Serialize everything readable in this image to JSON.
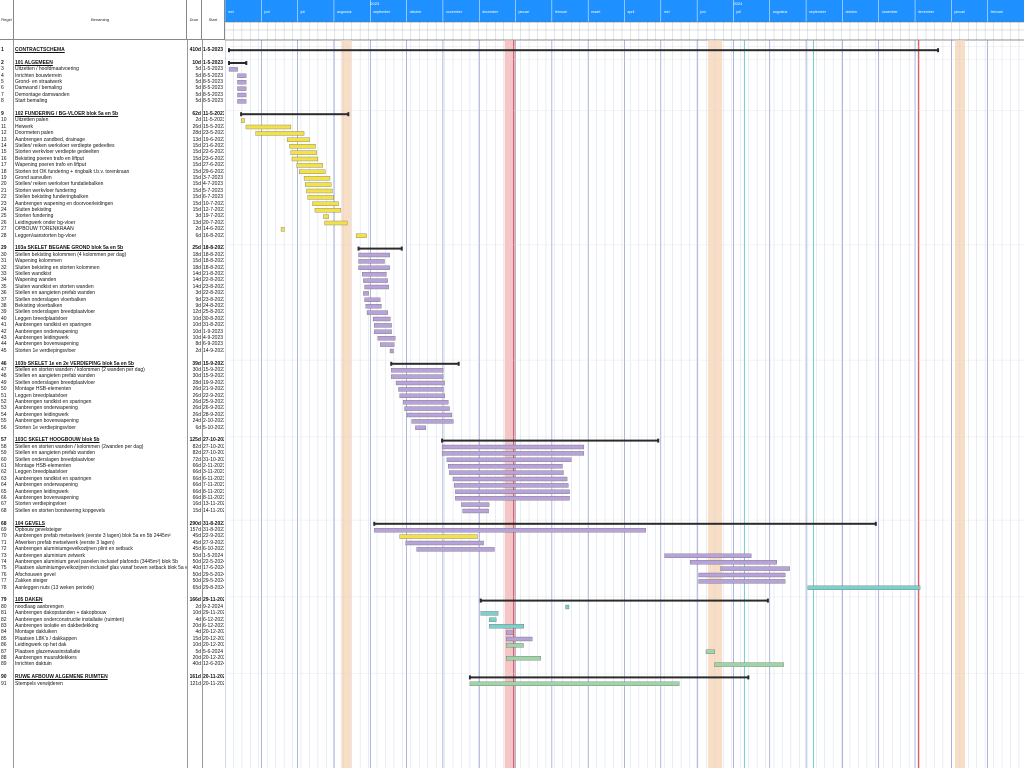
{
  "table": {
    "headers": {
      "id": "Regel",
      "name": "Benaming",
      "duration": "Duur",
      "start": "Start"
    },
    "rows": [
      {
        "n": "1",
        "name": "CONTRACTSCHEMA",
        "dur": "410d",
        "start": "1-5-2023",
        "summary": true
      },
      {
        "n": "",
        "name": "",
        "dur": "",
        "start": ""
      },
      {
        "n": "2",
        "name": "101 ALGEMEEN",
        "dur": "10d",
        "start": "1-5-2023",
        "summary": true
      },
      {
        "n": "3",
        "name": "Uitzetten / hoofdmaatvoering",
        "dur": "5d",
        "start": "1-5-2023"
      },
      {
        "n": "4",
        "name": "Inrichten bouwterrein",
        "dur": "5d",
        "start": "8-5-2023"
      },
      {
        "n": "5",
        "name": "Grond- en straatwerk",
        "dur": "5d",
        "start": "8-5-2023"
      },
      {
        "n": "6",
        "name": "Damwand / bemaling",
        "dur": "5d",
        "start": "8-5-2023"
      },
      {
        "n": "7",
        "name": "Demontage damwanden",
        "dur": "5d",
        "start": "8-5-2023"
      },
      {
        "n": "8",
        "name": "Start bemaling",
        "dur": "5d",
        "start": "8-5-2023"
      },
      {
        "n": "",
        "name": "",
        "dur": "",
        "start": ""
      },
      {
        "n": "9",
        "name": "102 FUNDERING / BG-VLOER blok 5a en 5b",
        "dur": "62d",
        "start": "11-5-2023",
        "summary": true
      },
      {
        "n": "10",
        "name": "Uitzetten palen",
        "dur": "2d",
        "start": "11-5-2023"
      },
      {
        "n": "11",
        "name": "Heiwerk",
        "dur": "26d",
        "start": "15-5-2023"
      },
      {
        "n": "12",
        "name": "Doormeten palen",
        "dur": "28d",
        "start": "23-5-2023"
      },
      {
        "n": "13",
        "name": "Aanbrengen zandbed, drainage",
        "dur": "13d",
        "start": "19-6-2023"
      },
      {
        "n": "14",
        "name": "Stellen/ reiken werkvloer verdiepte gedeeltes",
        "dur": "15d",
        "start": "21-6-2023"
      },
      {
        "n": "15",
        "name": "Storten werkvloer verdiepte gedeelten",
        "dur": "15d",
        "start": "22-6-2023"
      },
      {
        "n": "16",
        "name": "Bekisting poeren trafo en liftput",
        "dur": "15d",
        "start": "23-6-2023"
      },
      {
        "n": "17",
        "name": "Wapening poeren trafo en liftput",
        "dur": "15d",
        "start": "27-6-2023"
      },
      {
        "n": "18",
        "name": "Storten tot OK fundering + ringbalk t.b.v. torenkraan",
        "dur": "15d",
        "start": "29-6-2023"
      },
      {
        "n": "19",
        "name": "Grond aanvullen",
        "dur": "15d",
        "start": "3-7-2023"
      },
      {
        "n": "20",
        "name": "Stellen/ reiken werkvloer fundatiebalken",
        "dur": "15d",
        "start": "4-7-2023"
      },
      {
        "n": "21",
        "name": "Storten werkvloer fundering",
        "dur": "15d",
        "start": "5-7-2023"
      },
      {
        "n": "22",
        "name": "Stellen bekisting funderingbalken",
        "dur": "15d",
        "start": "6-7-2023"
      },
      {
        "n": "23",
        "name": "Aanbrengen wapening en doorvoerleidingen",
        "dur": "15d",
        "start": "10-7-2023"
      },
      {
        "n": "24",
        "name": "Sluiten bekisting",
        "dur": "15d",
        "start": "12-7-2023"
      },
      {
        "n": "25",
        "name": "Storten fundering",
        "dur": "3d",
        "start": "19-7-2023"
      },
      {
        "n": "26",
        "name": "Leidingwerk onder bg-vloer",
        "dur": "13d",
        "start": "20-7-2023"
      },
      {
        "n": "27",
        "name": "OPBOUW TORENKRAAN",
        "dur": "2d",
        "start": "14-6-2023"
      },
      {
        "n": "28",
        "name": "Leggen/aanstorten bg-vloer",
        "dur": "6d",
        "start": "16-8-2023"
      },
      {
        "n": "",
        "name": "",
        "dur": "",
        "start": ""
      },
      {
        "n": "29",
        "name": "103a SKELET BEGANE GROND blok 5a en 5b",
        "dur": "25d",
        "start": "18-8-2023",
        "summary": true
      },
      {
        "n": "30",
        "name": "Stellen bekisting kolommen (4 kolommen per dag)",
        "dur": "18d",
        "start": "18-8-2023"
      },
      {
        "n": "31",
        "name": "Wapening kolommen",
        "dur": "15d",
        "start": "18-8-2023"
      },
      {
        "n": "32",
        "name": "Sluiten bekisting en storten kolommen",
        "dur": "18d",
        "start": "18-8-2023"
      },
      {
        "n": "33",
        "name": "Stellen wandkist",
        "dur": "14d",
        "start": "21-8-2023"
      },
      {
        "n": "34",
        "name": "Wapening wanden",
        "dur": "14d",
        "start": "22-8-2023"
      },
      {
        "n": "35",
        "name": "Sluiten wandkist en storten wanden",
        "dur": "14d",
        "start": "23-8-2023"
      },
      {
        "n": "36",
        "name": "Stellen en aangieten prefab wanden",
        "dur": "3d",
        "start": "22-8-2023"
      },
      {
        "n": "37",
        "name": "Stellen onderslagen vloerbalken",
        "dur": "9d",
        "start": "23-8-2023"
      },
      {
        "n": "38",
        "name": "Bekisting vloerbalken",
        "dur": "9d",
        "start": "24-8-2023"
      },
      {
        "n": "39",
        "name": "Stellen onderslagen breedplaatvloer",
        "dur": "12d",
        "start": "25-8-2023"
      },
      {
        "n": "40",
        "name": "Leggen breedplaatvloer",
        "dur": "10d",
        "start": "30-8-2023"
      },
      {
        "n": "41",
        "name": "Aanbrengen randkist en sparingen",
        "dur": "10d",
        "start": "31-8-2023"
      },
      {
        "n": "42",
        "name": "Aanbrengen onderwapening",
        "dur": "10d",
        "start": "1-9-2023"
      },
      {
        "n": "43",
        "name": "Aanbrengen leidingwerk",
        "dur": "10d",
        "start": "4-9-2023"
      },
      {
        "n": "44",
        "name": "Aanbrengen bovenwapening",
        "dur": "8d",
        "start": "6-9-2023"
      },
      {
        "n": "45",
        "name": "Storten 1e verdiepingsvloer",
        "dur": "2d",
        "start": "14-9-2023"
      },
      {
        "n": "",
        "name": "",
        "dur": "",
        "start": ""
      },
      {
        "n": "46",
        "name": "103b SKELET 1e en 2e VERDIEPING blok 5a en 5b",
        "dur": "39d",
        "start": "15-9-2023",
        "summary": true
      },
      {
        "n": "47",
        "name": "Stellen en storten wanden / kolommen (2 wanden per dag)",
        "dur": "30d",
        "start": "15-9-2023"
      },
      {
        "n": "48",
        "name": "Stellen en aangieten prefab wanden",
        "dur": "30d",
        "start": "15-9-2023"
      },
      {
        "n": "49",
        "name": "Stellen onderslagen breedplaatvloer",
        "dur": "28d",
        "start": "19-9-2023"
      },
      {
        "n": "50",
        "name": "Montage HSB-elementen",
        "dur": "26d",
        "start": "21-9-2023"
      },
      {
        "n": "51",
        "name": "Leggen breedplaatvloer",
        "dur": "26d",
        "start": "22-9-2023"
      },
      {
        "n": "52",
        "name": "Aanbrengen randkist en sparingen",
        "dur": "26d",
        "start": "25-9-2023"
      },
      {
        "n": "53",
        "name": "Aanbrengen onderwapening",
        "dur": "26d",
        "start": "26-9-2023"
      },
      {
        "n": "54",
        "name": "Aanbrengen leidingwerk",
        "dur": "26d",
        "start": "28-9-2023"
      },
      {
        "n": "55",
        "name": "Aanbrengen bovenwapening",
        "dur": "24d",
        "start": "2-10-2023"
      },
      {
        "n": "56",
        "name": "Storten 1e verdiepingsvloer",
        "dur": "6d",
        "start": "5-10-2023"
      },
      {
        "n": "",
        "name": "",
        "dur": "",
        "start": ""
      },
      {
        "n": "57",
        "name": "103C SKELET HOOGBOUW blok 5b",
        "dur": "125d",
        "start": "27-10-2023",
        "summary": true
      },
      {
        "n": "58",
        "name": "Stellen en storten wanden / kolommen (2wanden per dag)",
        "dur": "82d",
        "start": "27-10-2023"
      },
      {
        "n": "59",
        "name": "Stellen en aangieten prefab wanden",
        "dur": "82d",
        "start": "27-10-2023"
      },
      {
        "n": "60",
        "name": "Stellen onderslagen breedplaatvloer",
        "dur": "72d",
        "start": "31-10-2023"
      },
      {
        "n": "61",
        "name": "Montage HSB-elementen",
        "dur": "66d",
        "start": "2-11-2023"
      },
      {
        "n": "62",
        "name": "Leggen breedplaatvloer",
        "dur": "66d",
        "start": "3-11-2023"
      },
      {
        "n": "63",
        "name": "Aanbrengen randkist en sparingen",
        "dur": "66d",
        "start": "6-11-2023"
      },
      {
        "n": "64",
        "name": "Aanbrengen onderwapening",
        "dur": "66d",
        "start": "7-11-2023"
      },
      {
        "n": "65",
        "name": "Aanbrengen leidingwerk",
        "dur": "66d",
        "start": "8-11-2023"
      },
      {
        "n": "66",
        "name": "Aanbrengen bovenwapening",
        "dur": "66d",
        "start": "8-11-2023"
      },
      {
        "n": "67",
        "name": "Storten verdiepingvloer",
        "dur": "16d",
        "start": "13-11-2023"
      },
      {
        "n": "68",
        "name": "Stellen en storten borstwering kopgevels",
        "dur": "15d",
        "start": "14-11-2023"
      },
      {
        "n": "",
        "name": "",
        "dur": "",
        "start": ""
      },
      {
        "n": "68",
        "name": "104 GEVELS",
        "dur": "290d",
        "start": "31-8-2023",
        "summary": true
      },
      {
        "n": "69",
        "name": "Opbouw gevelsteiger",
        "dur": "157d",
        "start": "31-8-2023"
      },
      {
        "n": "70",
        "name": "Aanbrengen prefab metselwerk (eerste 3 lagen) blok 5a en 5b 2445m²",
        "dur": "45d",
        "start": "22-9-2023"
      },
      {
        "n": "71",
        "name": "Afwerken prefab metselwerk (eerste 3 lagen)",
        "dur": "45d",
        "start": "27-9-2023"
      },
      {
        "n": "72",
        "name": "Aanbrengen aluminiumgevelkozijnen plint en setback",
        "dur": "45d",
        "start": "6-10-2023"
      },
      {
        "n": "73",
        "name": "Aanbrengen aluminium zetwerk",
        "dur": "50d",
        "start": "1-5-2024"
      },
      {
        "n": "74",
        "name": "Aanbrengen aluminium gevel panelen inclusief plafonds (3445m²) blok 5b",
        "dur": "50d",
        "start": "22-5-2024"
      },
      {
        "n": "75",
        "name": "Plaatsen aluminiumgevelkozijnen inclusief glas vanaf boven setback blok 5a en 5b",
        "dur": "40d",
        "start": "17-6-2024"
      },
      {
        "n": "76",
        "name": "Afschouwen gevel",
        "dur": "50d",
        "start": "29-5-2024"
      },
      {
        "n": "77",
        "name": "Zakken steiger",
        "dur": "50d",
        "start": "29-5-2024"
      },
      {
        "n": "78",
        "name": "Aanleggen nuts (13 weken periode)",
        "dur": "65d",
        "start": "29-8-2024"
      },
      {
        "n": "",
        "name": "",
        "dur": "",
        "start": ""
      },
      {
        "n": "79",
        "name": "105 DAKEN",
        "dur": "166d",
        "start": "29-11-2023",
        "summary": true
      },
      {
        "n": "80",
        "name": "noodlaag aanbrengen",
        "dur": "2d",
        "start": "9-2-2024"
      },
      {
        "n": "81",
        "name": "Aanbrengen dakopstanden + dakopbouw",
        "dur": "10d",
        "start": "29-11-2023"
      },
      {
        "n": "82",
        "name": "Aanbrengen onderconstructie installatie (ruimten)",
        "dur": "4d",
        "start": "6-12-2023"
      },
      {
        "n": "83",
        "name": "Aanbrengen isolatie en dakbedekking",
        "dur": "20d",
        "start": "6-12-2023"
      },
      {
        "n": "84",
        "name": "Montage dakluiken",
        "dur": "4d",
        "start": "20-12-2023"
      },
      {
        "n": "85",
        "name": "Plaatsen L8K's / dakkappen",
        "dur": "15d",
        "start": "20-12-2023"
      },
      {
        "n": "86",
        "name": "Leidingwerk op het dak",
        "dur": "10d",
        "start": "20-12-2023"
      },
      {
        "n": "87",
        "name": "Plaatsen glazenwasinstallatie",
        "dur": "5d",
        "start": "5-6-2024"
      },
      {
        "n": "88",
        "name": "Aanbrengen muurafdekkers",
        "dur": "20d",
        "start": "20-12-2023"
      },
      {
        "n": "89",
        "name": "Inrichten daktuin",
        "dur": "40d",
        "start": "12-6-2024"
      },
      {
        "n": "",
        "name": "",
        "dur": "",
        "start": ""
      },
      {
        "n": "90",
        "name": "RUWE AFBOUW ALGEMENE RUIMTEN",
        "dur": "161d",
        "start": "20-11-2023",
        "summary": true
      },
      {
        "n": "91",
        "name": "Stempels verwijderen",
        "dur": "121d",
        "start": "20-11-2023"
      }
    ]
  },
  "timeline": {
    "years": [
      "2023",
      "2024"
    ],
    "months": [
      "mei",
      "juni",
      "juli",
      "augustus",
      "september",
      "oktober",
      "november",
      "december",
      "januari",
      "februari",
      "maart",
      "april",
      "mei",
      "juni",
      "juli",
      "augustus",
      "september",
      "oktober",
      "november",
      "december",
      "januari",
      "februari"
    ],
    "month_header_color": "#1e90ff",
    "bar_colors": {
      "purple": "#b7a3d9",
      "yellow": "#f2e14a",
      "green": "#9fd3a8",
      "teal": "#7ecfc9",
      "summary": "#2b2b2b"
    },
    "holiday_colors": [
      "#f7d6b8",
      "#f4b8b8",
      "#f7d6b8"
    ]
  }
}
